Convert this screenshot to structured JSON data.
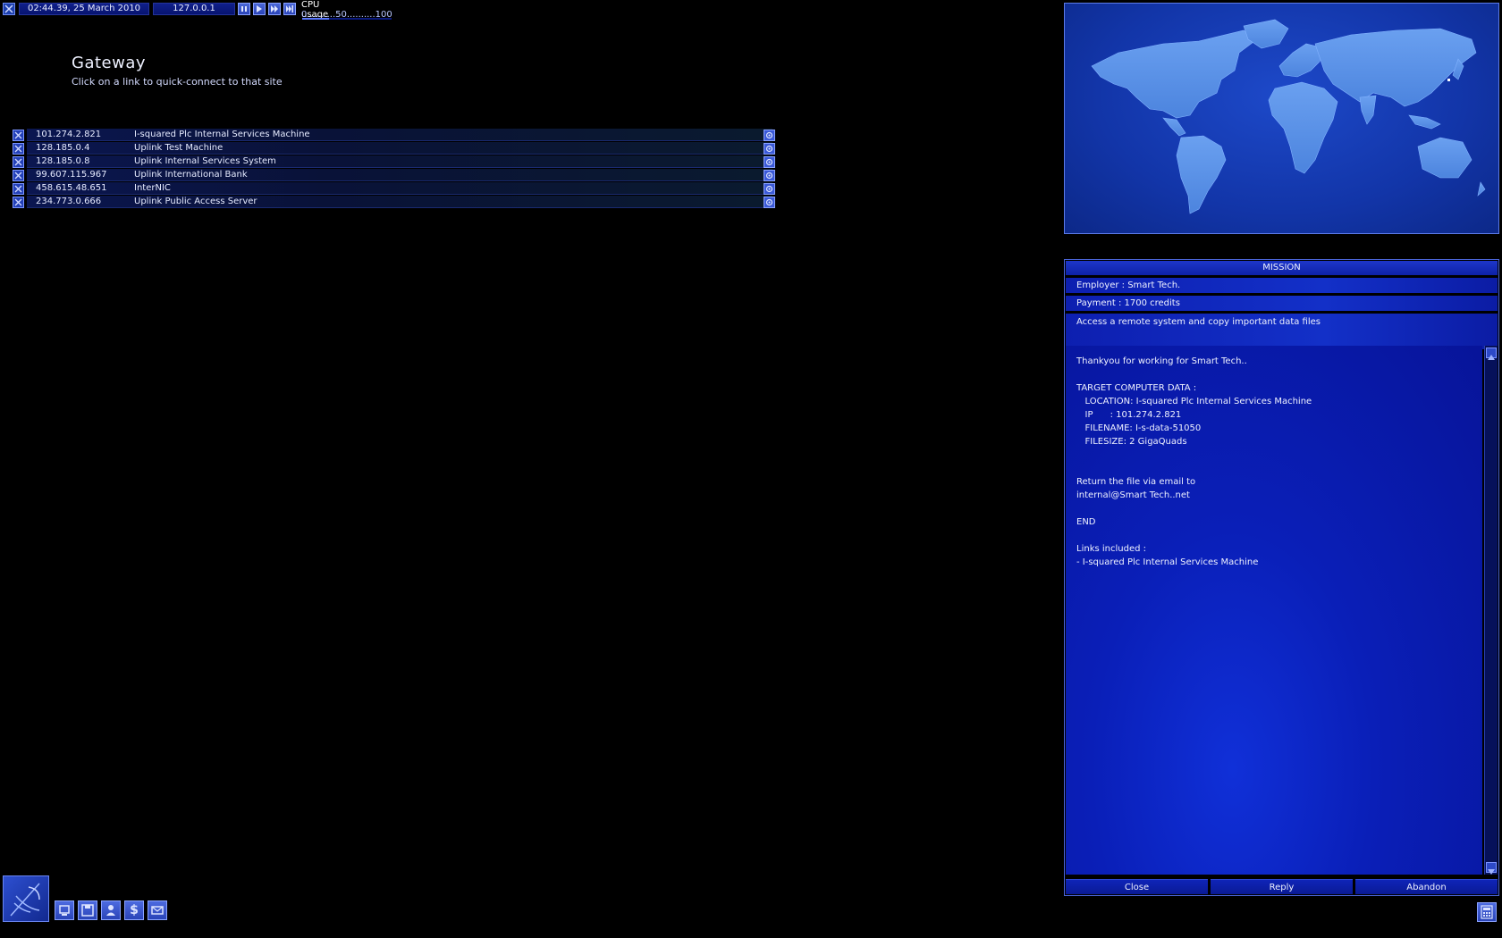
{
  "topbar": {
    "datetime": "02:44.39, 25 March 2010",
    "ip": "127.0.0.1",
    "cpu_label": "CPU usage",
    "cpu_scale": "0..........50..........100",
    "cpu_percent": 30,
    "speed_buttons": [
      "pause-icon",
      "play-icon",
      "fast-forward-icon",
      "fastest-forward-icon"
    ]
  },
  "gateway": {
    "title": "Gateway",
    "subtitle": "Click on a link to quick-connect to that site"
  },
  "links": [
    {
      "ip": "101.274.2.821",
      "name": "I-squared Plc Internal Services Machine"
    },
    {
      "ip": "128.185.0.4",
      "name": "Uplink Test Machine"
    },
    {
      "ip": "128.185.0.8",
      "name": "Uplink Internal Services System"
    },
    {
      "ip": "99.607.115.967",
      "name": "Uplink International Bank"
    },
    {
      "ip": "458.615.48.651",
      "name": "InterNIC"
    },
    {
      "ip": "234.773.0.666",
      "name": "Uplink Public Access Server"
    }
  ],
  "mission": {
    "title": "MISSION",
    "employer": "Employer : Smart Tech.",
    "payment": "Payment : 1700 credits",
    "description": "Access a remote system and copy important data files",
    "body_lines": [
      "Thankyou for working for Smart Tech..",
      "",
      "TARGET COMPUTER DATA :",
      "   LOCATION: I-squared Plc Internal Services Machine",
      "   IP      : 101.274.2.821",
      "   FILENAME: I-s-data-51050",
      "   FILESIZE: 2 GigaQuads",
      "",
      "",
      "Return the file via email to",
      "internal@Smart Tech..net",
      "",
      "END",
      "",
      "Links included :",
      "- I-squared Plc Internal Services Machine"
    ],
    "buttons": {
      "close": "Close",
      "reply": "Reply",
      "abandon": "Abandon"
    }
  },
  "dock": {
    "items": [
      "satellite-dish-icon",
      "computer-icon",
      "floppy-disk-icon",
      "person-icon",
      "dollar-icon",
      "mail-icon"
    ],
    "dollar_glyph": "$"
  },
  "colors": {
    "panel_blue": "#0a1fb8",
    "map_blue": "#1d49c9",
    "land_blue": "#5b93ea",
    "accent": "#8aa2ff"
  }
}
